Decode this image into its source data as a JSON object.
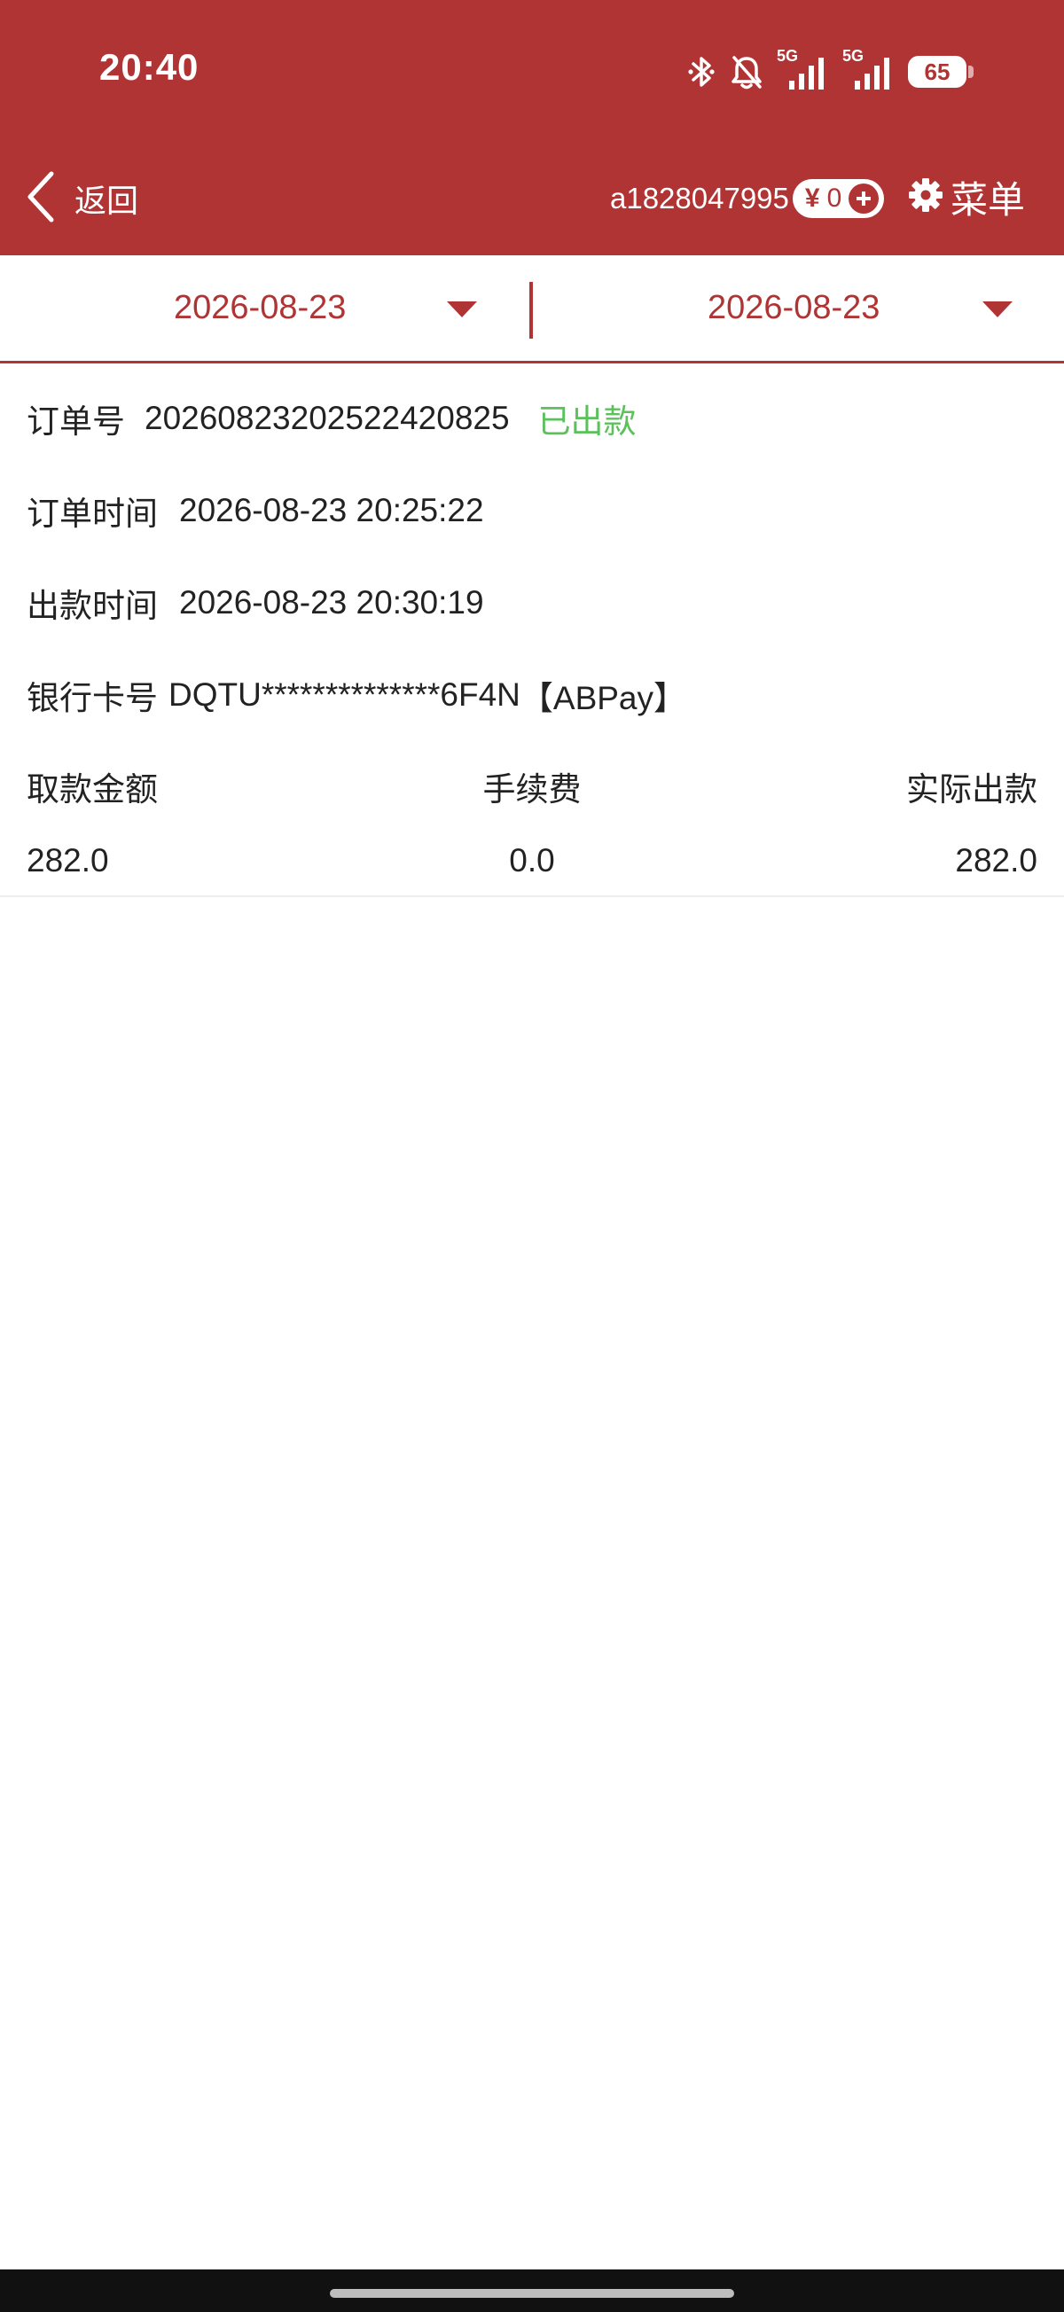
{
  "status_bar": {
    "time": "20:40",
    "network_1": "5G",
    "network_2": "5G",
    "battery_level": "65"
  },
  "app_bar": {
    "back_label": "返回",
    "account_id": "a1828047995",
    "currency_symbol": "¥",
    "balance": "0",
    "menu_label": "菜单",
    "brand_color": "#b03434"
  },
  "date_range": {
    "start_date": "2026-08-23",
    "end_date": "2026-08-23"
  },
  "record": {
    "order_no_label": "订单号",
    "order_no": "20260823202522420825",
    "status": "已出款",
    "status_color": "#5cc05c",
    "order_time_label": "订单时间",
    "order_time": "2026-08-23 20:25:22",
    "payout_time_label": "出款时间",
    "payout_time": "2026-08-23 20:30:19",
    "bank_label": "银行卡号",
    "bank_card": "DQTU**************6F4N",
    "bank_channel": "【ABPay】",
    "columns": [
      "取款金额",
      "手续费",
      "实际出款"
    ],
    "values": [
      "282.0",
      "0.0",
      "282.0"
    ]
  }
}
